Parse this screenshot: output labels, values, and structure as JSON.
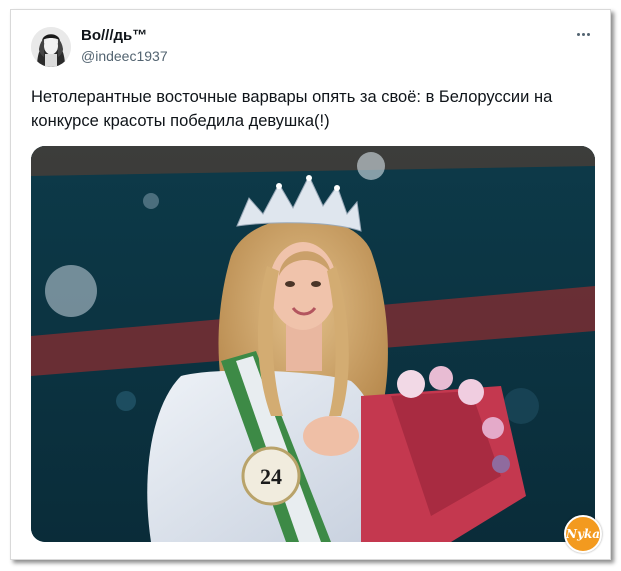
{
  "tweet": {
    "author_name": "Bo///дь™",
    "author_handle": "@indeec1937",
    "text": "Нетолерантные восточные варвары опять за своё: в Белоруссии на\nконкурсе красоты победила девушка(!)",
    "more_icon": "more-horizontal-icon"
  },
  "media": {
    "sash_number": "24",
    "watermark_text": "Nyka"
  },
  "colors": {
    "text_primary": "#0f1419",
    "text_secondary": "#536471",
    "watermark": "#f39a1f",
    "stage_background": "#0e3c4c",
    "bouquet": "#c4384f"
  }
}
